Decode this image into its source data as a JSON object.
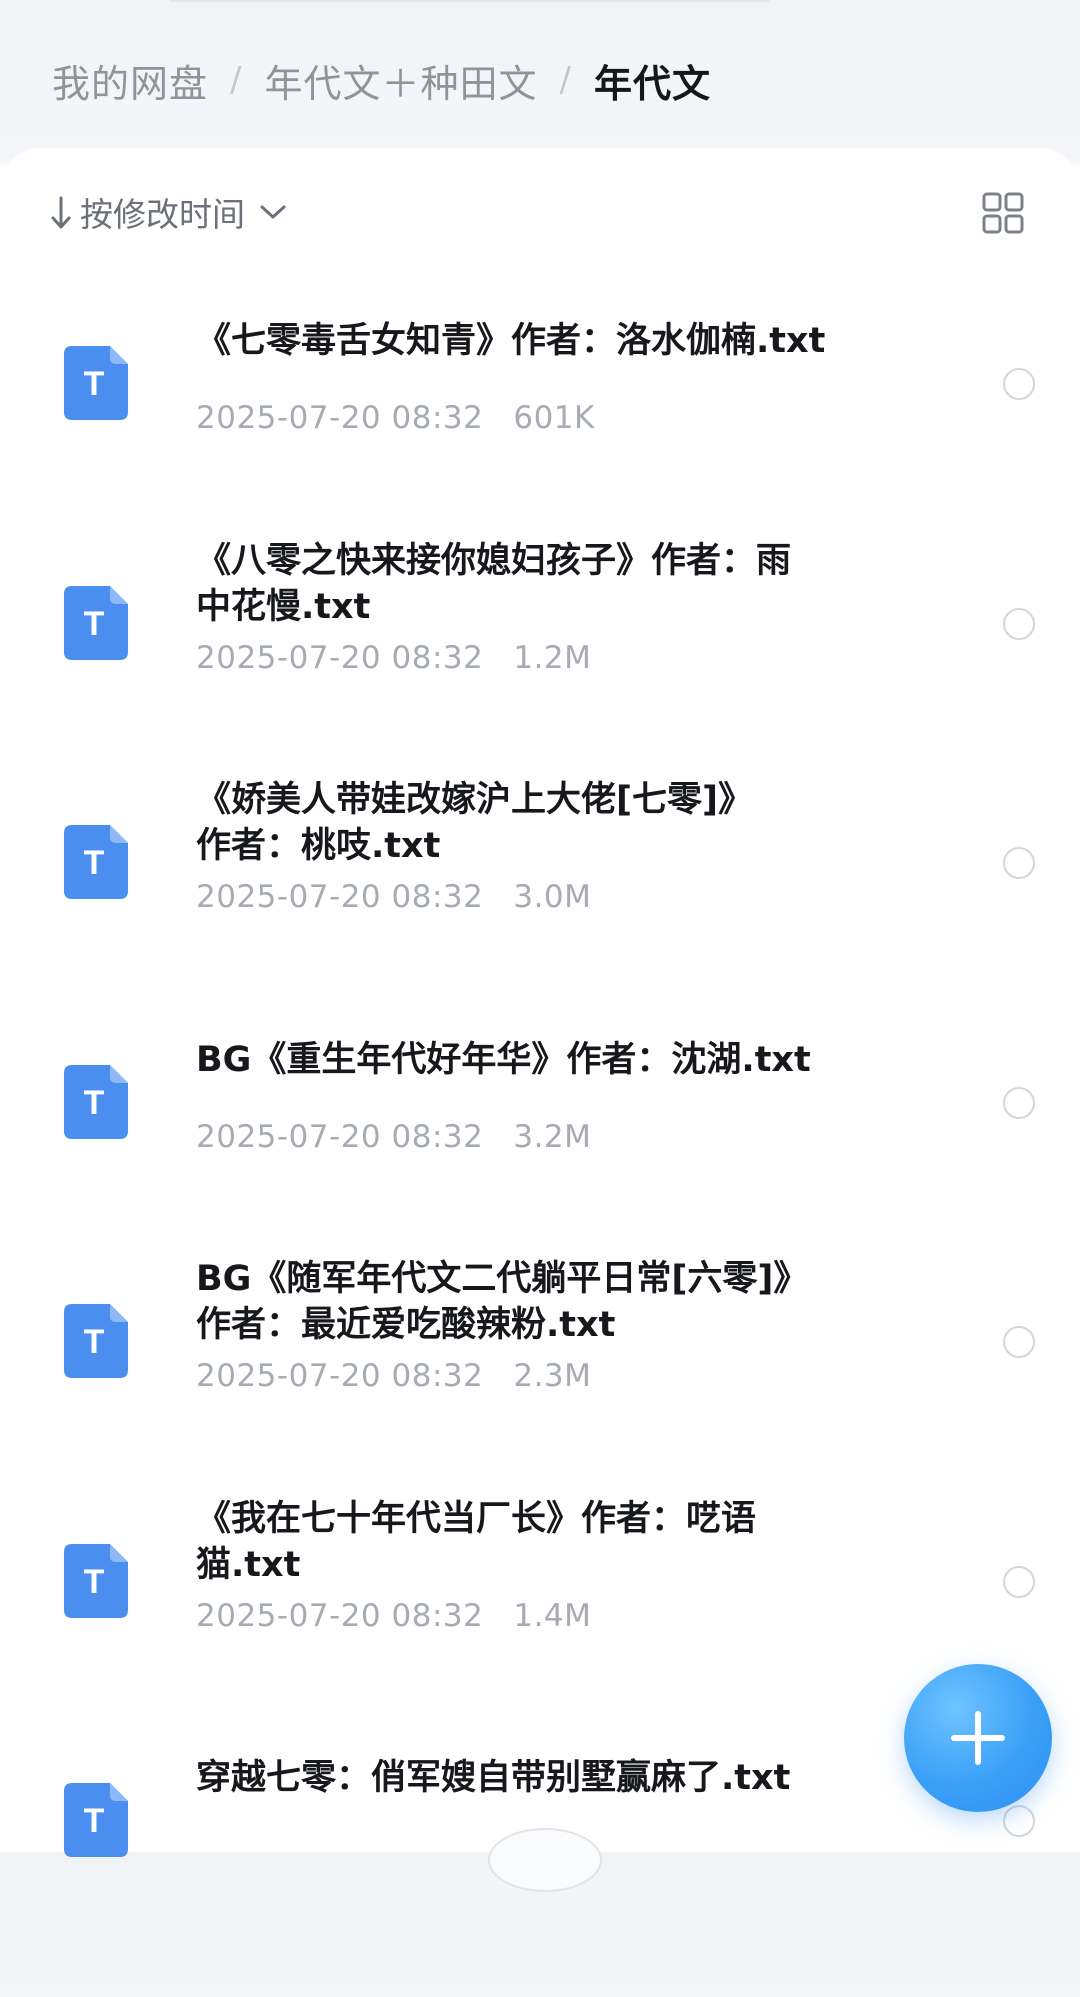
{
  "breadcrumb": {
    "items": [
      "我的网盘",
      "年代文＋种田文",
      "年代文"
    ],
    "separator": "/"
  },
  "toolbar": {
    "sort_label": "按修改时间",
    "sort_direction_icon": "down-arrow-icon",
    "view_toggle_icon": "grid-view-icon"
  },
  "files": [
    {
      "line1": "《七零毒舌女知青》作者：洛水伽楠.txt",
      "line2": "",
      "date": "2025-07-20 08:32",
      "size": "601K"
    },
    {
      "line1": "《八零之快来接你媳妇孩子》作者：雨",
      "line2": "中花慢.txt",
      "date": "2025-07-20 08:32",
      "size": "1.2M"
    },
    {
      "line1": "《娇美人带娃改嫁沪上大佬[七零]》",
      "line2": "作者：桃吱.txt",
      "date": "2025-07-20 08:32",
      "size": "3.0M"
    },
    {
      "line1": "BG《重生年代好年华》作者：沈湖.txt",
      "line2": "",
      "date": "2025-07-20 08:32",
      "size": "3.2M"
    },
    {
      "line1": "BG《随军年代文二代躺平日常[六零]》",
      "line2": "作者：最近爱吃酸辣粉.txt",
      "date": "2025-07-20 08:32",
      "size": "2.3M"
    },
    {
      "line1": "《我在七十年代当厂长》作者：呓语",
      "line2": "猫.txt",
      "date": "2025-07-20 08:32",
      "size": "1.4M"
    },
    {
      "line1": "穿越七零：俏军嫂自带别墅赢麻了.txt",
      "line2": "",
      "date": "",
      "size": ""
    }
  ],
  "file_icon_letter": "T",
  "colors": {
    "accent": "#3a9cf5",
    "file_icon": "#4a8ff0",
    "meta_text": "#a7abb2"
  },
  "fab": {
    "icon": "plus-icon"
  }
}
